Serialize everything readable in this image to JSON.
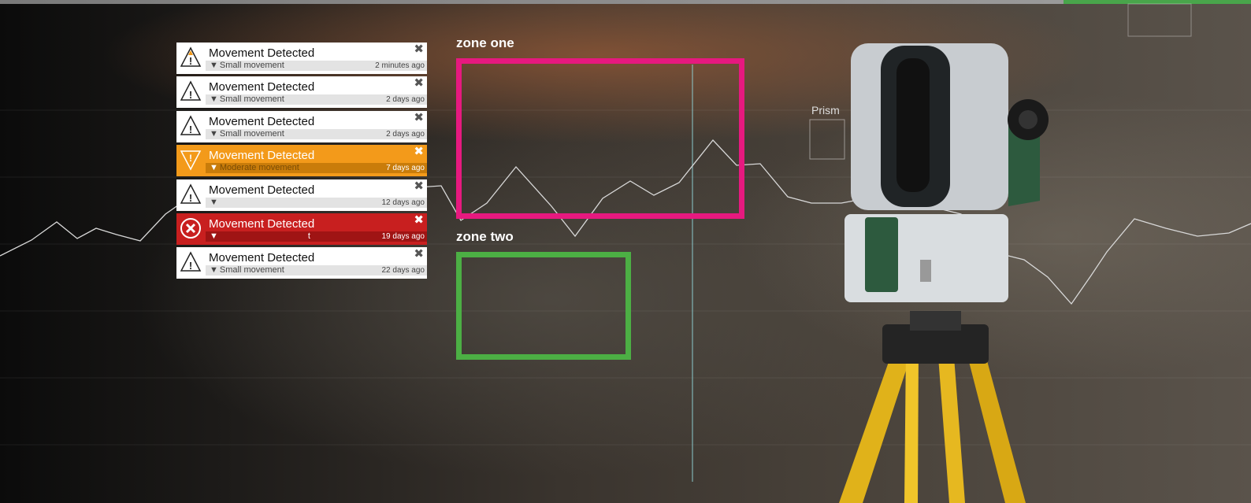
{
  "zones": [
    {
      "label": "zone one",
      "color": "#e6197f"
    },
    {
      "label": "zone two",
      "color": "#4caf44"
    }
  ],
  "prism_label": "Prism",
  "notifications": [
    {
      "title": "Movement Detected",
      "message": "Small movement",
      "age": "2 minutes ago",
      "severity": "info-new",
      "icon": "warning-triangle-icon"
    },
    {
      "title": "Movement Detected",
      "message": "Small movement",
      "age": "2 days ago",
      "severity": "info",
      "icon": "warning-triangle-icon"
    },
    {
      "title": "Movement Detected",
      "message": "Small movement",
      "age": "2 days ago",
      "severity": "info",
      "icon": "warning-triangle-icon"
    },
    {
      "title": "Movement Detected",
      "message": "Moderate movement",
      "age": "7 days ago",
      "severity": "warning",
      "icon": "warning-triangle-icon"
    },
    {
      "title": "Movement Detected",
      "message": "",
      "age": "12 days ago",
      "severity": "info",
      "icon": "warning-triangle-icon"
    },
    {
      "title": "Movement Detected",
      "message": "t",
      "age": "19 days ago",
      "severity": "error",
      "icon": "error-circle-icon"
    },
    {
      "title": "Movement Detected",
      "message": "Small movement",
      "age": "22 days ago",
      "severity": "info",
      "icon": "warning-triangle-icon"
    }
  ],
  "close_glyph": "✖",
  "expand_glyph": "▼",
  "colors": {
    "warning": "#f39a1a",
    "error": "#c81f1f",
    "zone_one": "#e6197f",
    "zone_two": "#4caf44"
  }
}
